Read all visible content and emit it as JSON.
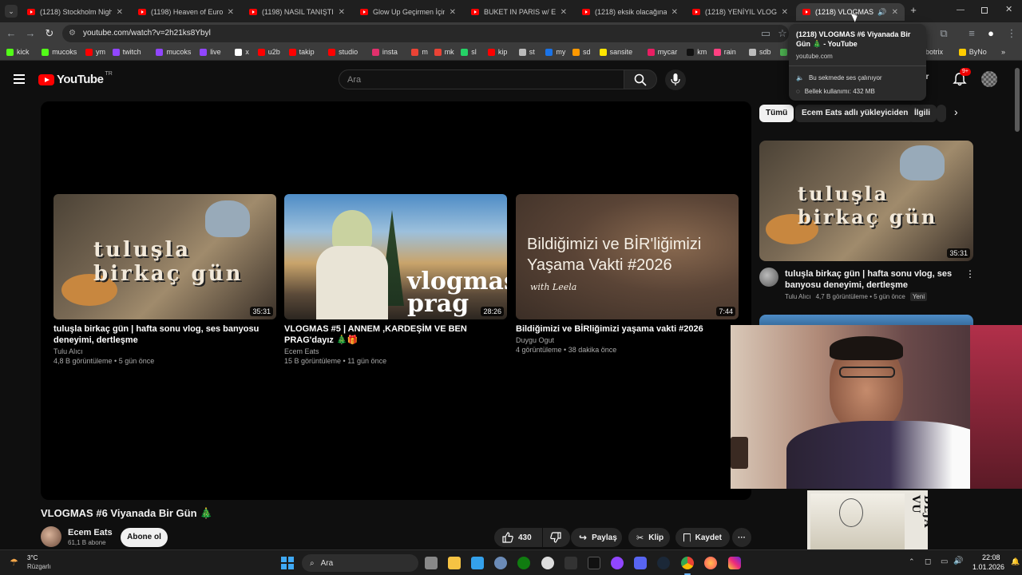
{
  "browser": {
    "tabs": [
      {
        "title": "(1218) Stockholm Nightlife"
      },
      {
        "title": "(1198) Heaven of Europe"
      },
      {
        "title": "(1198) NASIL TANIŞTIK?| "
      },
      {
        "title": "Glow Up Geçirmen İçin 10"
      },
      {
        "title": "BUKET IN PARIS w/ EDA Y"
      },
      {
        "title": "(1218) eksik olacağına fa"
      },
      {
        "title": "(1218) YENİYIL VLOG #20"
      },
      {
        "title": "(1218) VLOGMAS #6"
      }
    ],
    "url": "youtube.com/watch?v=2h21ks8Ybyl",
    "bookmarks": [
      {
        "label": "kick",
        "color": "#53fc18"
      },
      {
        "label": "mucoks",
        "color": "#53fc18"
      },
      {
        "label": "ym",
        "color": "#ff0000"
      },
      {
        "label": "twitch",
        "color": "#9146ff"
      },
      {
        "label": "mucoks",
        "color": "#9146ff"
      },
      {
        "label": "live",
        "color": "#9146ff"
      },
      {
        "label": "x",
        "color": "#ffffff"
      },
      {
        "label": "u2b",
        "color": "#ff0000"
      },
      {
        "label": "takip",
        "color": "#ff0000"
      },
      {
        "label": "studio",
        "color": "#ff0000"
      },
      {
        "label": "insta",
        "color": "#e1306c"
      },
      {
        "label": "m",
        "color": "#ea4335"
      },
      {
        "label": "mk",
        "color": "#ea4335"
      },
      {
        "label": "sl",
        "color": "#25d366"
      },
      {
        "label": "kip",
        "color": "#ff0000"
      },
      {
        "label": "st",
        "color": "#bbbbbb"
      },
      {
        "label": "my",
        "color": "#1a73e8"
      },
      {
        "label": "sd",
        "color": "#ff9900"
      },
      {
        "label": "sansite",
        "color": "#ffe600"
      },
      {
        "label": "mycar",
        "color": "#e91e63"
      },
      {
        "label": "km",
        "color": "#111111"
      },
      {
        "label": "rain",
        "color": "#ff4081"
      },
      {
        "label": "sdb",
        "color": "#bbbbbb"
      },
      {
        "label": "ik",
        "color": "#4caf50"
      },
      {
        "label": "dos",
        "color": "#4caf50"
      },
      {
        "label": "botrix",
        "color": "#888888"
      },
      {
        "label": "ByNo",
        "color": "#ffcc00"
      }
    ],
    "popup": {
      "title": "(1218) VLOGMAS #6 Viyanada Bir Gün 🎄 - YouTube",
      "domain": "youtube.com",
      "audio": "Bu sekmede ses çalınıyor",
      "memory": "Bellek kullanımı: 432 MB"
    }
  },
  "youtube": {
    "logo": "YouTube",
    "region": "TR",
    "search_placeholder": "Ara",
    "notif_count": "9+",
    "signin_partial": "tur",
    "video_title": "VLOGMAS #6 Viyanada Bir Gün 🎄",
    "channel": {
      "name": "Ecem Eats",
      "subs": "61,1 B abone",
      "subscribe": "Abone ol"
    },
    "actions": {
      "likes": "430",
      "share": "Paylaş",
      "clip": "Klip",
      "save": "Kaydet"
    },
    "endcards": [
      {
        "title": "tuluşla birkaç gün | hafta sonu vlog, ses banyosu deneyimi, dertleşme",
        "channel": "Tulu Alıcı",
        "meta": "4,8 B görüntüleme • 5 gün önce",
        "duration": "35:31",
        "overlay": "tuluşla birkaç gün"
      },
      {
        "title": "VLOGMAS #5 | ANNEM ,KARDEŞİM VE BEN PRAG'dayız 🎄🎁",
        "channel": "Ecem Eats",
        "meta": "15 B görüntüleme • 11 gün önce",
        "duration": "28:26",
        "overlay": "vlogmas prag"
      },
      {
        "title": "Bildiğimizi ve BİRliğimizi yaşama vakti #2026",
        "channel": "Duygu Ogut",
        "meta": "4 görüntüleme • 38 dakika önce",
        "duration": "7:44",
        "overlay": "Bildiğimizi ve BİR'liğimizi Yaşama Vakti #2026",
        "overlay2": "with Leela"
      }
    ],
    "chips": [
      "Tümü",
      "Ecem Eats adlı yükleyiciden",
      "İlgili"
    ],
    "related": [
      {
        "title": "tuluşla birkaç gün | hafta sonu vlog, ses banyosu deneyimi, dertleşme",
        "channel": "Tulu Alıcı",
        "meta": "4,7 B görüntüleme • 5 gün önce",
        "badge": "Yeni",
        "duration": "35:31"
      }
    ]
  },
  "art": {
    "text": "DÉJÀ VU"
  },
  "taskbar": {
    "weather_temp": "3°C",
    "weather_desc": "Rüzgarlı",
    "search": "Ara",
    "time": "22:08",
    "date": "1.01.2026"
  }
}
